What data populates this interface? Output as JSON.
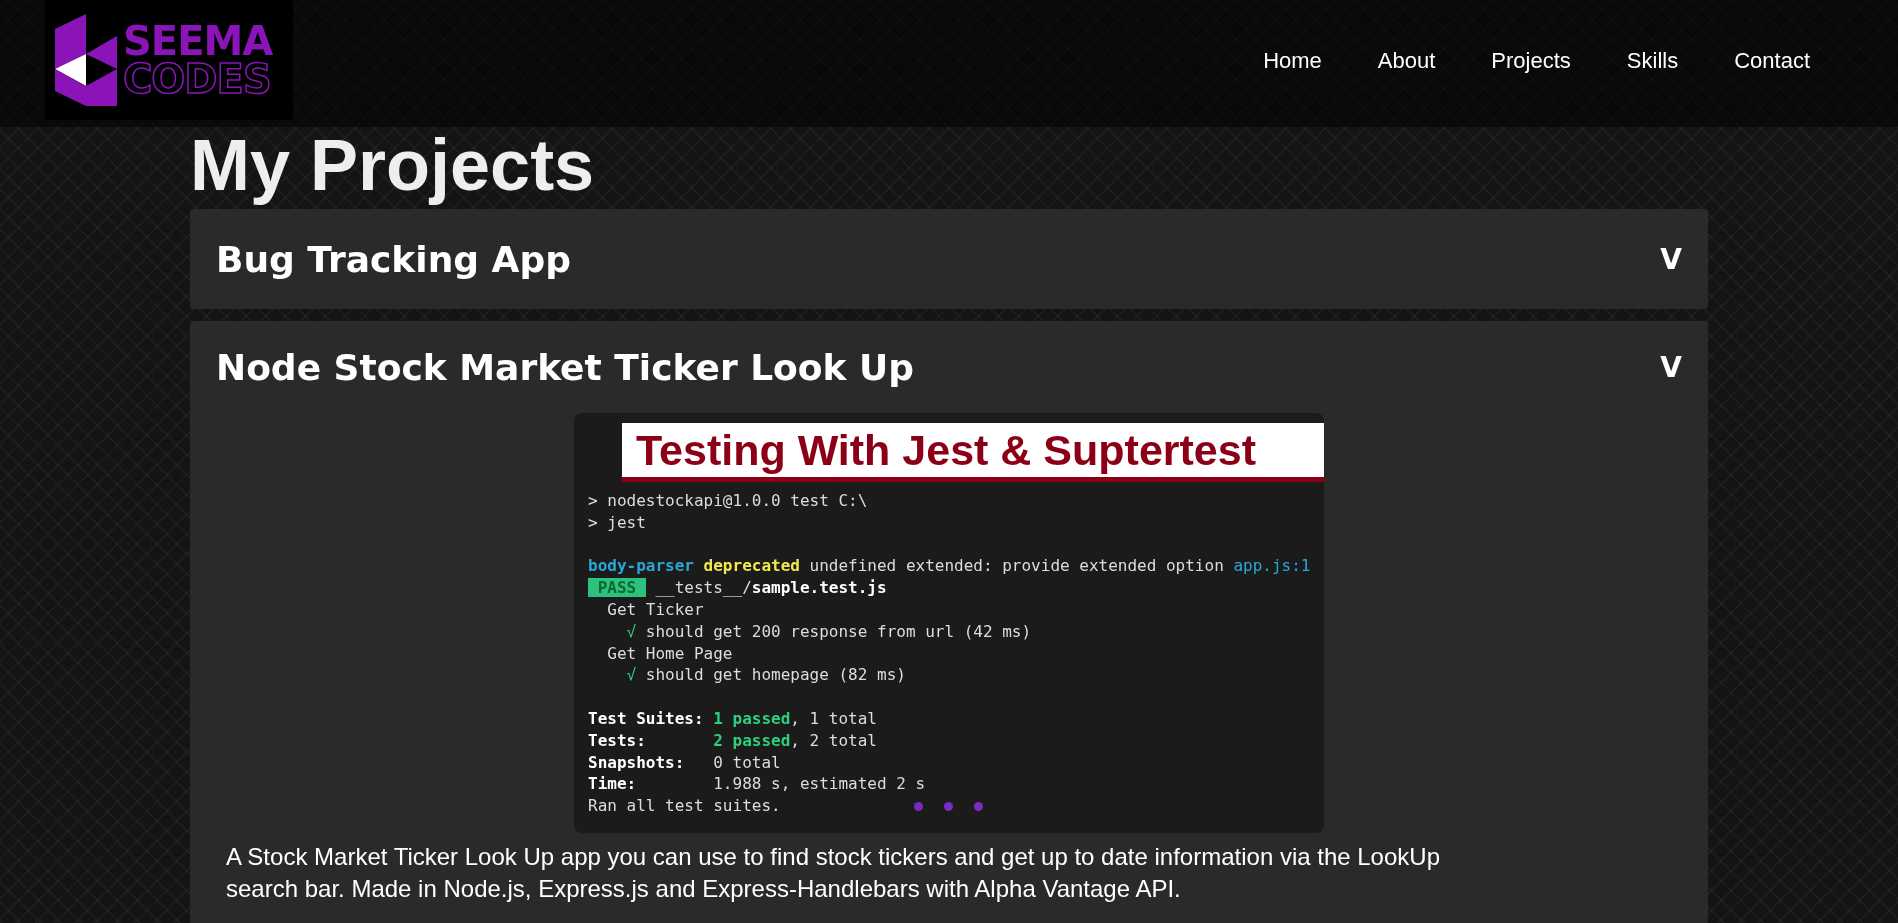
{
  "logo": {
    "line_1": "SEEMA",
    "line_2": "CODES"
  },
  "nav": [
    {
      "label": "Home"
    },
    {
      "label": "About"
    },
    {
      "label": "Projects"
    },
    {
      "label": "Skills"
    },
    {
      "label": "Contact"
    }
  ],
  "page_title": "My Projects",
  "projects": [
    {
      "title": "Bug Tracking App",
      "toggle": "V",
      "expanded": false
    },
    {
      "title": "Node Stock Market Ticker Look Up",
      "toggle": "V",
      "expanded": true,
      "screenshot": {
        "heading": "Testing With Jest & Suptertest",
        "lines": [
          {
            "break_before": false,
            "parts": [
              {
                "kind": "plain",
                "text": "> nodestockapi@1.0.0 test C:\\"
              }
            ]
          },
          {
            "break_before": false,
            "parts": [
              {
                "kind": "plain",
                "text": "> jest"
              }
            ]
          },
          {
            "break_before": true,
            "parts": [
              {
                "kind": "cyan",
                "text": "body-parser "
              },
              {
                "kind": "yellow",
                "text": "deprecated"
              },
              {
                "kind": "plain",
                "text": " undefined extended: provide extended option "
              },
              {
                "kind": "link",
                "text": "app.js:1"
              }
            ]
          },
          {
            "break_before": false,
            "parts": [
              {
                "kind": "badge",
                "text": " PASS "
              },
              {
                "kind": "plain",
                "text": " __tests__/"
              },
              {
                "kind": "bold",
                "text": "sample.test.js"
              }
            ]
          },
          {
            "break_before": false,
            "parts": [
              {
                "kind": "plain",
                "text": "  Get Ticker"
              }
            ]
          },
          {
            "break_before": false,
            "parts": [
              {
                "kind": "check",
                "text": "    √"
              },
              {
                "kind": "plain",
                "text": " should get 200 response from url (42 ms)"
              }
            ]
          },
          {
            "break_before": false,
            "parts": [
              {
                "kind": "plain",
                "text": "  Get Home Page"
              }
            ]
          },
          {
            "break_before": false,
            "parts": [
              {
                "kind": "check",
                "text": "    √"
              },
              {
                "kind": "plain",
                "text": " should get homepage (82 ms)"
              }
            ]
          },
          {
            "break_before": true,
            "parts": [
              {
                "kind": "bold",
                "text": "Test Suites: "
              },
              {
                "kind": "green",
                "text": "1 passed"
              },
              {
                "kind": "plain",
                "text": ", 1 total"
              }
            ]
          },
          {
            "break_before": false,
            "parts": [
              {
                "kind": "bold",
                "text": "Tests:       "
              },
              {
                "kind": "green",
                "text": "2 passed"
              },
              {
                "kind": "plain",
                "text": ", 2 total"
              }
            ]
          },
          {
            "break_before": false,
            "parts": [
              {
                "kind": "bold",
                "text": "Snapshots:"
              },
              {
                "kind": "plain",
                "text": "   0 total"
              }
            ]
          },
          {
            "break_before": false,
            "parts": [
              {
                "kind": "bold",
                "text": "Time:"
              },
              {
                "kind": "plain",
                "text": "        1.988 s, estimated 2 s"
              }
            ]
          },
          {
            "break_before": false,
            "parts": [
              {
                "kind": "plain",
                "text": "Ran all test suites."
              }
            ]
          }
        ]
      },
      "description": "A Stock Market Ticker Look Up app you can use to find stock tickers and get up to date information via the LookUp search bar. Made in Node.js, Express.js and Express-Handlebars with Alpha Vantage API."
    }
  ]
}
